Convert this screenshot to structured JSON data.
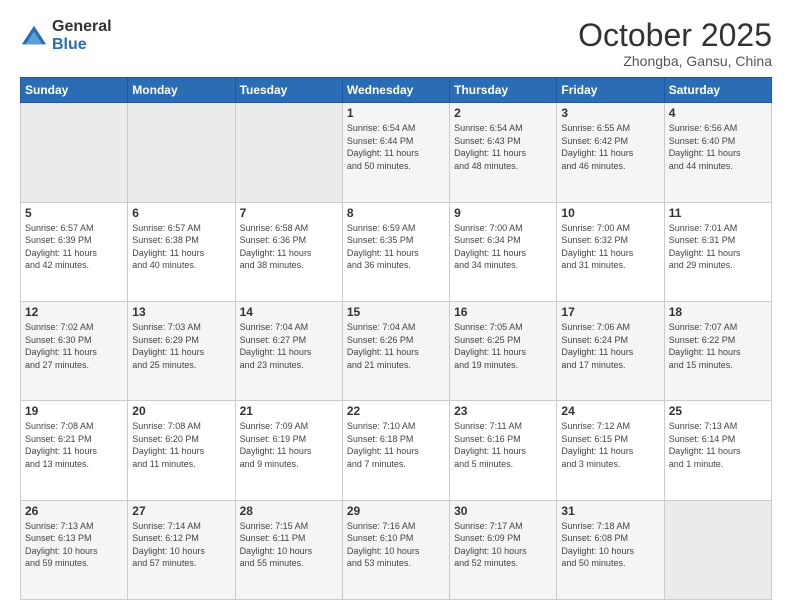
{
  "header": {
    "logo_general": "General",
    "logo_blue": "Blue",
    "month_title": "October 2025",
    "subtitle": "Zhongba, Gansu, China"
  },
  "days_of_week": [
    "Sunday",
    "Monday",
    "Tuesday",
    "Wednesday",
    "Thursday",
    "Friday",
    "Saturday"
  ],
  "weeks": [
    [
      {
        "day": "",
        "info": ""
      },
      {
        "day": "",
        "info": ""
      },
      {
        "day": "",
        "info": ""
      },
      {
        "day": "1",
        "info": "Sunrise: 6:54 AM\nSunset: 6:44 PM\nDaylight: 11 hours\nand 50 minutes."
      },
      {
        "day": "2",
        "info": "Sunrise: 6:54 AM\nSunset: 6:43 PM\nDaylight: 11 hours\nand 48 minutes."
      },
      {
        "day": "3",
        "info": "Sunrise: 6:55 AM\nSunset: 6:42 PM\nDaylight: 11 hours\nand 46 minutes."
      },
      {
        "day": "4",
        "info": "Sunrise: 6:56 AM\nSunset: 6:40 PM\nDaylight: 11 hours\nand 44 minutes."
      }
    ],
    [
      {
        "day": "5",
        "info": "Sunrise: 6:57 AM\nSunset: 6:39 PM\nDaylight: 11 hours\nand 42 minutes."
      },
      {
        "day": "6",
        "info": "Sunrise: 6:57 AM\nSunset: 6:38 PM\nDaylight: 11 hours\nand 40 minutes."
      },
      {
        "day": "7",
        "info": "Sunrise: 6:58 AM\nSunset: 6:36 PM\nDaylight: 11 hours\nand 38 minutes."
      },
      {
        "day": "8",
        "info": "Sunrise: 6:59 AM\nSunset: 6:35 PM\nDaylight: 11 hours\nand 36 minutes."
      },
      {
        "day": "9",
        "info": "Sunrise: 7:00 AM\nSunset: 6:34 PM\nDaylight: 11 hours\nand 34 minutes."
      },
      {
        "day": "10",
        "info": "Sunrise: 7:00 AM\nSunset: 6:32 PM\nDaylight: 11 hours\nand 31 minutes."
      },
      {
        "day": "11",
        "info": "Sunrise: 7:01 AM\nSunset: 6:31 PM\nDaylight: 11 hours\nand 29 minutes."
      }
    ],
    [
      {
        "day": "12",
        "info": "Sunrise: 7:02 AM\nSunset: 6:30 PM\nDaylight: 11 hours\nand 27 minutes."
      },
      {
        "day": "13",
        "info": "Sunrise: 7:03 AM\nSunset: 6:29 PM\nDaylight: 11 hours\nand 25 minutes."
      },
      {
        "day": "14",
        "info": "Sunrise: 7:04 AM\nSunset: 6:27 PM\nDaylight: 11 hours\nand 23 minutes."
      },
      {
        "day": "15",
        "info": "Sunrise: 7:04 AM\nSunset: 6:26 PM\nDaylight: 11 hours\nand 21 minutes."
      },
      {
        "day": "16",
        "info": "Sunrise: 7:05 AM\nSunset: 6:25 PM\nDaylight: 11 hours\nand 19 minutes."
      },
      {
        "day": "17",
        "info": "Sunrise: 7:06 AM\nSunset: 6:24 PM\nDaylight: 11 hours\nand 17 minutes."
      },
      {
        "day": "18",
        "info": "Sunrise: 7:07 AM\nSunset: 6:22 PM\nDaylight: 11 hours\nand 15 minutes."
      }
    ],
    [
      {
        "day": "19",
        "info": "Sunrise: 7:08 AM\nSunset: 6:21 PM\nDaylight: 11 hours\nand 13 minutes."
      },
      {
        "day": "20",
        "info": "Sunrise: 7:08 AM\nSunset: 6:20 PM\nDaylight: 11 hours\nand 11 minutes."
      },
      {
        "day": "21",
        "info": "Sunrise: 7:09 AM\nSunset: 6:19 PM\nDaylight: 11 hours\nand 9 minutes."
      },
      {
        "day": "22",
        "info": "Sunrise: 7:10 AM\nSunset: 6:18 PM\nDaylight: 11 hours\nand 7 minutes."
      },
      {
        "day": "23",
        "info": "Sunrise: 7:11 AM\nSunset: 6:16 PM\nDaylight: 11 hours\nand 5 minutes."
      },
      {
        "day": "24",
        "info": "Sunrise: 7:12 AM\nSunset: 6:15 PM\nDaylight: 11 hours\nand 3 minutes."
      },
      {
        "day": "25",
        "info": "Sunrise: 7:13 AM\nSunset: 6:14 PM\nDaylight: 11 hours\nand 1 minute."
      }
    ],
    [
      {
        "day": "26",
        "info": "Sunrise: 7:13 AM\nSunset: 6:13 PM\nDaylight: 10 hours\nand 59 minutes."
      },
      {
        "day": "27",
        "info": "Sunrise: 7:14 AM\nSunset: 6:12 PM\nDaylight: 10 hours\nand 57 minutes."
      },
      {
        "day": "28",
        "info": "Sunrise: 7:15 AM\nSunset: 6:11 PM\nDaylight: 10 hours\nand 55 minutes."
      },
      {
        "day": "29",
        "info": "Sunrise: 7:16 AM\nSunset: 6:10 PM\nDaylight: 10 hours\nand 53 minutes."
      },
      {
        "day": "30",
        "info": "Sunrise: 7:17 AM\nSunset: 6:09 PM\nDaylight: 10 hours\nand 52 minutes."
      },
      {
        "day": "31",
        "info": "Sunrise: 7:18 AM\nSunset: 6:08 PM\nDaylight: 10 hours\nand 50 minutes."
      },
      {
        "day": "",
        "info": ""
      }
    ]
  ]
}
